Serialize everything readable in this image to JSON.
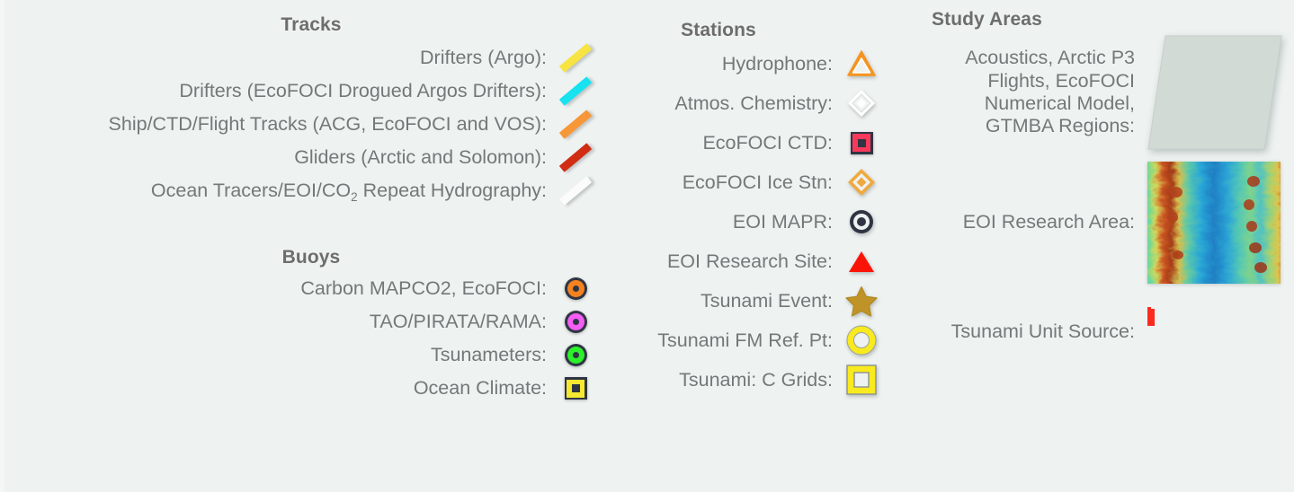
{
  "background_color": "#eef2f1",
  "text_color": "#737878",
  "heading_color": "#6d6d6d",
  "columns": {
    "tracks": {
      "heading": "Tracks",
      "rows": [
        {
          "label": "Drifters (Argo):",
          "icon": "track-line-yellow",
          "color": "#f7e443"
        },
        {
          "label": "Drifters (EcoFOCI Drogued Argos Drifters):",
          "icon": "track-line-cyan",
          "color": "#16e2f0"
        },
        {
          "label": "Ship/CTD/Flight Tracks (ACG, EcoFOCI and VOS):",
          "icon": "track-line-orange",
          "color": "#f79738"
        },
        {
          "label": "Gliders (Arctic and Solomon):",
          "icon": "track-line-red",
          "color": "#d12d13"
        },
        {
          "label_pre": "Ocean Tracers/EOI/CO",
          "label_sub": "2",
          "label_post": " Repeat Hydrography:",
          "icon": "track-line-white",
          "color": "#fbfbfb"
        }
      ]
    },
    "buoys": {
      "heading": "Buoys",
      "rows": [
        {
          "label": "Carbon MAPCO2, EcoFOCI:",
          "icon": "donut-marker-orange",
          "color": "#f58220"
        },
        {
          "label": "TAO/PIRATA/RAMA:",
          "icon": "donut-marker-magenta",
          "color": "#f45ef4"
        },
        {
          "label": "Tsunameters:",
          "icon": "donut-marker-green",
          "color": "#2bf02b"
        },
        {
          "label": "Ocean Climate:",
          "icon": "square-marker-yellow",
          "color": "#f5e830"
        }
      ]
    },
    "stations": {
      "heading": "Stations",
      "rows": [
        {
          "label": "Hydrophone:",
          "icon": "triangle-outline-orange-icon",
          "color": "#f5941f"
        },
        {
          "label": "Atmos. Chemistry:",
          "icon": "diamond-outline-white-icon",
          "color": "#ffffff"
        },
        {
          "label": "EcoFOCI CTD:",
          "icon": "square-marker-pink-icon",
          "color": "#f9395c"
        },
        {
          "label": "EcoFOCI Ice Stn:",
          "icon": "diamond-outline-orange-icon",
          "color": "#f0a93e"
        },
        {
          "label": "EOI MAPR:",
          "icon": "bullseye-dark-icon",
          "color": "#2f3542"
        },
        {
          "label": "EOI Research Site:",
          "icon": "triangle-filled-red-icon",
          "color": "#fa1408"
        },
        {
          "label": "Tsunami Event:",
          "icon": "star-filled-gold-icon",
          "color": "#bf9327"
        },
        {
          "label": "Tsunami FM Ref. Pt:",
          "icon": "ring-yellow-icon",
          "color": "#f8ea1e"
        },
        {
          "label": "Tsunami: C Grids:",
          "icon": "square-outline-yellow-icon",
          "color": "#f8ea1e"
        }
      ]
    },
    "study_areas": {
      "heading": "Study Areas",
      "rows": [
        {
          "label": "Acoustics, Arctic P3\nFlights, EcoFOCI\nNumerical Model,\nGTMBA Regions:",
          "icon": "parallelogram-grey-polygon",
          "color": "#d2dad6"
        },
        {
          "label": "EOI Research Area:",
          "icon": "bathymetry-thumbnail-image",
          "color": "#2aa7d0"
        },
        {
          "label": "Tsunami Unit Source:",
          "icon": "red-unit-source-rectangles",
          "color": "#fb2b20"
        }
      ]
    }
  }
}
